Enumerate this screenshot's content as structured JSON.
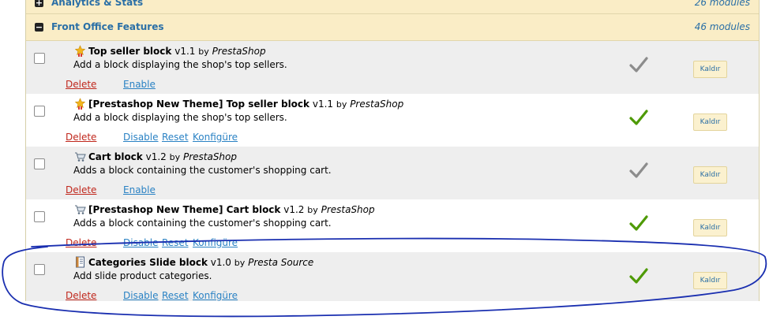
{
  "categories": [
    {
      "title": "Analytics & Stats",
      "count": "26 modules",
      "toggle": "+"
    },
    {
      "title": "Front Office Features",
      "count": "46 modules",
      "toggle": "−"
    }
  ],
  "modules": [
    {
      "name": "Top seller block",
      "version": "v1.1",
      "by": "by",
      "author": "PrestaShop",
      "description": "Add a block displaying the shop's top sellers.",
      "delete": "Delete",
      "links": [
        "Enable"
      ],
      "status": "inactive",
      "button": "Kaldır",
      "icon": "award-icon"
    },
    {
      "name": "[Prestashop New Theme] Top seller block",
      "version": "v1.1",
      "by": "by",
      "author": "PrestaShop",
      "description": "Add a block displaying the shop's top sellers.",
      "delete": "Delete",
      "links": [
        "Disable",
        "Reset",
        "Konfigüre"
      ],
      "status": "active",
      "button": "Kaldır",
      "icon": "award-icon"
    },
    {
      "name": "Cart block",
      "version": "v1.2",
      "by": "by",
      "author": "PrestaShop",
      "description": "Adds a block containing the customer's shopping cart.",
      "delete": "Delete",
      "links": [
        "Enable"
      ],
      "status": "inactive",
      "button": "Kaldır",
      "icon": "cart-icon"
    },
    {
      "name": "[Prestashop New Theme] Cart block",
      "version": "v1.2",
      "by": "by",
      "author": "PrestaShop",
      "description": "Adds a block containing the customer's shopping cart.",
      "delete": "Delete",
      "links": [
        "Disable",
        "Reset",
        "Konfigüre"
      ],
      "status": "active",
      "button": "Kaldır",
      "icon": "cart-icon"
    },
    {
      "name": "Categories Slide block",
      "version": "v1.0",
      "by": "by",
      "author": "Presta Source",
      "description": "Add slide product categories.",
      "delete": "Delete",
      "links": [
        "Disable",
        "Reset",
        "Konfigüre"
      ],
      "status": "active",
      "button": "Kaldır",
      "icon": "document-icon"
    }
  ],
  "colors": {
    "active_check": "#4e9a06",
    "inactive_check": "#8c8c8c",
    "header_bg": "#faedc6",
    "link": "#2a82c4",
    "delete": "#c0271c",
    "annotation": "#1a2fb0"
  }
}
